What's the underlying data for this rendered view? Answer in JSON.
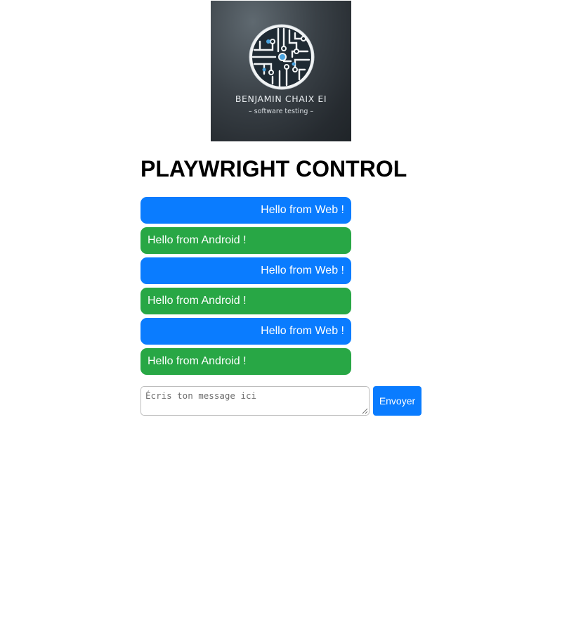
{
  "logo": {
    "title": "BENJAMIN CHAIX EI",
    "subtitle": "– software testing –",
    "icon": "circuit-brain-icon"
  },
  "heading": "PLAYWRIGHT CONTROL",
  "messages": [
    {
      "source": "web",
      "text": "Hello from Web !"
    },
    {
      "source": "android",
      "text": "Hello from Android !"
    },
    {
      "source": "web",
      "text": "Hello from Web !"
    },
    {
      "source": "android",
      "text": "Hello from Android !"
    },
    {
      "source": "web",
      "text": "Hello from Web !"
    },
    {
      "source": "android",
      "text": "Hello from Android !"
    }
  ],
  "composer": {
    "placeholder": "Écris ton message ici",
    "value": "",
    "send_label": "Envoyer"
  },
  "colors": {
    "web_bubble": "#0a7cff",
    "android_bubble": "#28a745",
    "send_button": "#0a7cff"
  }
}
